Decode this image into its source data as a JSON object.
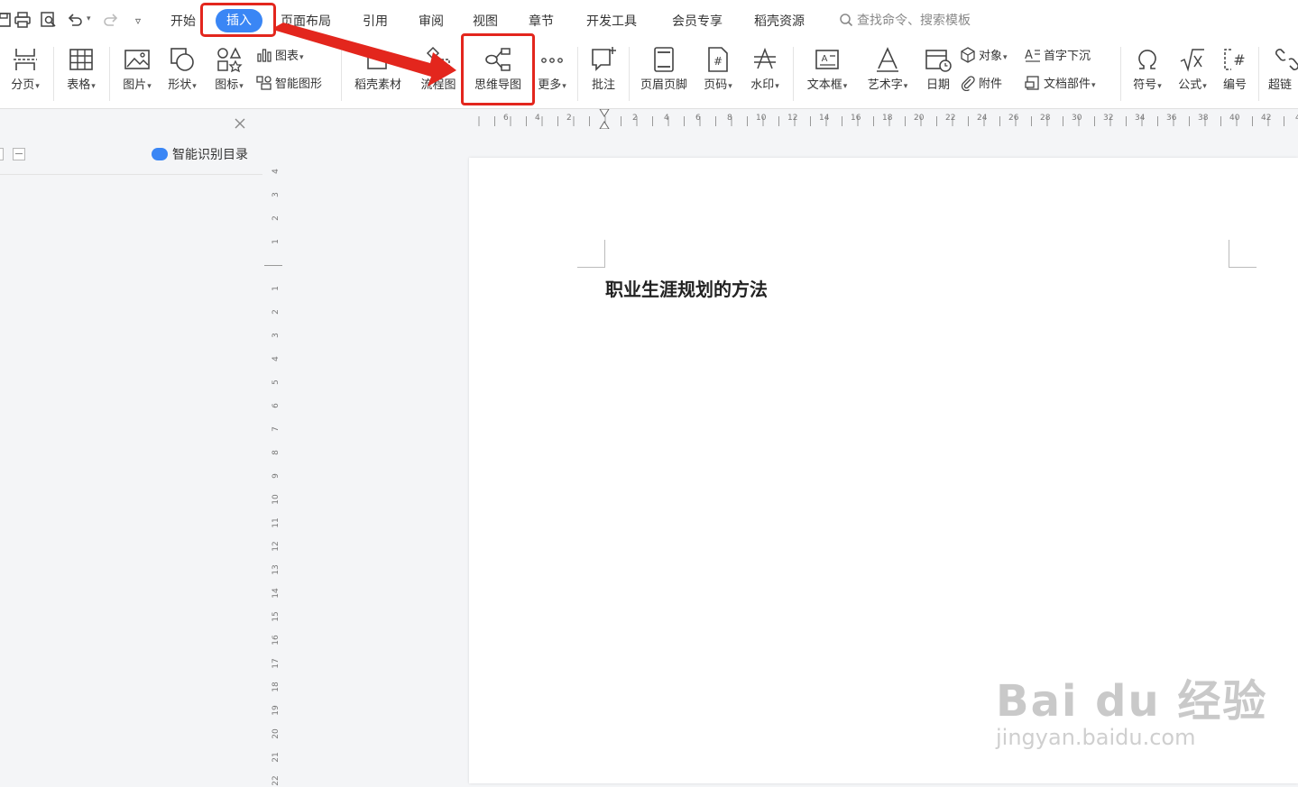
{
  "menu_tabs": [
    "开始",
    "插入",
    "页面布局",
    "引用",
    "审阅",
    "视图",
    "章节",
    "开发工具",
    "会员专享",
    "稻壳资源"
  ],
  "active_tab": "插入",
  "search": {
    "text": "查找命令、搜索模板"
  },
  "ribbon": {
    "page_break": "分页",
    "table": "表格",
    "picture": "图片",
    "shape": "形状",
    "icon": "图标",
    "chart": "图表",
    "smart_shape": "智能图形",
    "docer_material": "稻壳素材",
    "flowchart": "流程图",
    "mind_map": "思维导图",
    "more": "更多",
    "comment": "批注",
    "header_footer": "页眉页脚",
    "page_number": "页码",
    "watermark": "水印",
    "text_box": "文本框",
    "word_art": "艺术字",
    "date": "日期",
    "object": "对象",
    "drop_cap": "首字下沉",
    "attachment": "附件",
    "doc_parts": "文档部件",
    "symbol": "符号",
    "formula": "公式",
    "numbering": "编号",
    "hyperlink": "超链"
  },
  "left_pane": {
    "smart_toc": "智能识别目录"
  },
  "ruler": {
    "h_left": [
      "6",
      "4",
      "2"
    ],
    "h_right": [
      "2",
      "4",
      "6",
      "8",
      "10",
      "12",
      "14",
      "16",
      "18",
      "20",
      "22",
      "24",
      "26",
      "28",
      "30",
      "32",
      "34",
      "36",
      "38",
      "40",
      "42",
      "4"
    ],
    "v_top": [
      "4",
      "3",
      "2",
      "1"
    ],
    "v_bottom": [
      "1",
      "2",
      "3",
      "4",
      "5",
      "6",
      "7",
      "8",
      "9",
      "10",
      "11",
      "12",
      "13",
      "14",
      "15",
      "16",
      "17",
      "18",
      "19",
      "20",
      "21",
      "22"
    ]
  },
  "document": {
    "title": "职业生涯规划的方法"
  },
  "watermark": {
    "brand": "Bai du 经验",
    "url": "jingyan.baidu.com"
  },
  "colors": {
    "accent": "#3a86f5",
    "highlight": "#e3261d"
  }
}
